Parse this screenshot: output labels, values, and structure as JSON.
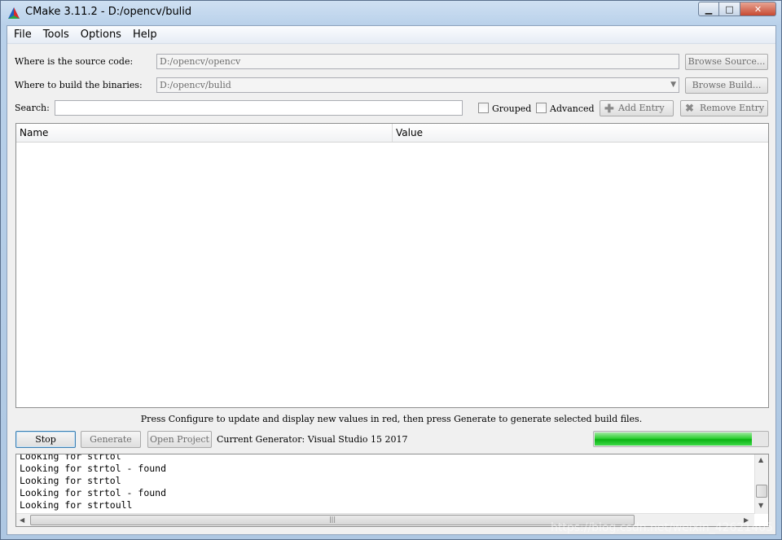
{
  "window": {
    "title": "CMake 3.11.2 - D:/opencv/bulid",
    "minimize_glyph": "▁",
    "maximize_glyph": "□",
    "close_glyph": "✕"
  },
  "menu": {
    "file": "File",
    "tools": "Tools",
    "options": "Options",
    "help": "Help"
  },
  "source": {
    "label": "Where is the source code:",
    "value": "D:/opencv/opencv",
    "browse_label": "Browse Source..."
  },
  "build": {
    "label": "Where to build the binaries:",
    "value": "D:/opencv/bulid",
    "browse_label": "Browse Build..."
  },
  "search": {
    "label": "Search:",
    "value": ""
  },
  "options": {
    "grouped_label": "Grouped",
    "advanced_label": "Advanced",
    "add_entry_label": "Add Entry",
    "remove_entry_label": "Remove Entry"
  },
  "table": {
    "columns": [
      "Name",
      "Value"
    ]
  },
  "hint": "Press Configure to update and display new values in red, then press Generate to generate selected build files.",
  "actions": {
    "stop_label": "Stop",
    "generate_label": "Generate",
    "open_project_label": "Open Project"
  },
  "generator": "Current Generator: Visual Studio 15 2017",
  "progress": {
    "fraction": 0.9
  },
  "log": {
    "lines": [
      "Looking for strtol",
      "Looking for strtol - found",
      "Looking for strtol",
      "Looking for strtol - found",
      "Looking for strtoull"
    ]
  },
  "watermark": "https://blog.csdn.net/weixin_42621405"
}
